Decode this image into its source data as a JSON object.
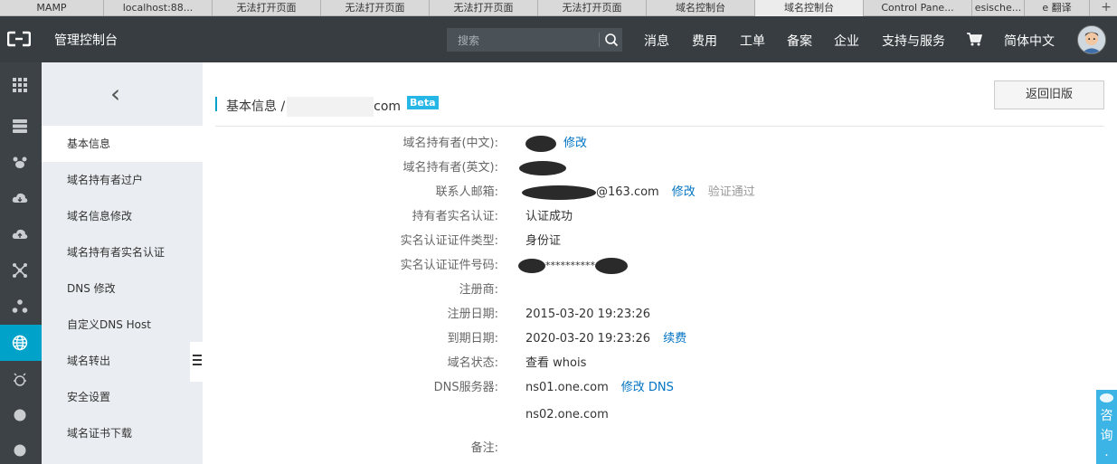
{
  "browser_tabs": [
    {
      "label": "MAMP",
      "active": false
    },
    {
      "label": "localhost:88...",
      "active": false
    },
    {
      "label": "无法打开页面",
      "active": false
    },
    {
      "label": "无法打开页面",
      "active": false
    },
    {
      "label": "无法打开页面",
      "active": false
    },
    {
      "label": "无法打开页面",
      "active": false
    },
    {
      "label": "域名控制台",
      "active": false
    },
    {
      "label": "域名控制台",
      "active": true
    },
    {
      "label": "Control Pane...",
      "active": false
    },
    {
      "label": "esische...",
      "active": false
    },
    {
      "label": "e 翻译",
      "active": false
    }
  ],
  "new_tab": "+",
  "header": {
    "title": "管理控制台",
    "search_placeholder": "搜索",
    "nav": [
      "消息",
      "费用",
      "工单",
      "备案",
      "企业",
      "支持与服务"
    ],
    "language": "简体中文"
  },
  "rail_icons": [
    "apps-grid-icon",
    "server-list-icon",
    "paw-icon",
    "cloud-download-icon",
    "cloud-upload-icon",
    "network-nodes-icon",
    "cluster-icon",
    "globe-icon",
    "bug-icon",
    "circle-icon",
    "circle-icon"
  ],
  "sidebar": {
    "back_label": "‹",
    "items": [
      "基本信息",
      "域名持有者过户",
      "域名信息修改",
      "域名持有者实名认证",
      "DNS 修改",
      "自定义DNS Host",
      "域名转出",
      "安全设置",
      "域名证书下载"
    ]
  },
  "page": {
    "breadcrumb_prefix": "基本信息 /",
    "breadcrumb_suffix": "com",
    "badge": "Beta",
    "back_old_label": "返回旧版"
  },
  "fields": [
    {
      "label": "域名持有者(中文):",
      "value": "",
      "link": "修改"
    },
    {
      "label": "域名持有者(英文):",
      "value": ""
    },
    {
      "label": "联系人邮箱:",
      "value": "@163.com",
      "link": "修改",
      "note": "验证通过"
    },
    {
      "label": "持有者实名认证:",
      "value": "认证成功"
    },
    {
      "label": "实名认证证件类型:",
      "value": "身份证"
    },
    {
      "label": "实名认证证件号码:",
      "value": "**********"
    },
    {
      "label": "注册商:",
      "value": ""
    },
    {
      "label": "注册日期:",
      "value": "2015-03-20 19:23:26"
    },
    {
      "label": "到期日期:",
      "value": "2020-03-20 19:23:26",
      "link": "续费"
    },
    {
      "label": "域名状态:",
      "value": "",
      "link": "查看 whois"
    },
    {
      "label": "DNS服务器:",
      "value": "ns01.one.com",
      "link": "修改 DNS"
    },
    {
      "label": "",
      "value": "ns02.one.com"
    },
    {
      "label": "备注:",
      "value": ""
    }
  ],
  "consult": "咨询·",
  "colors": {
    "topbar": "#373d41",
    "rail": "#3d4246",
    "accent": "#00a2ca",
    "link": "#0073c4",
    "sidebar": "#eaedf1"
  }
}
